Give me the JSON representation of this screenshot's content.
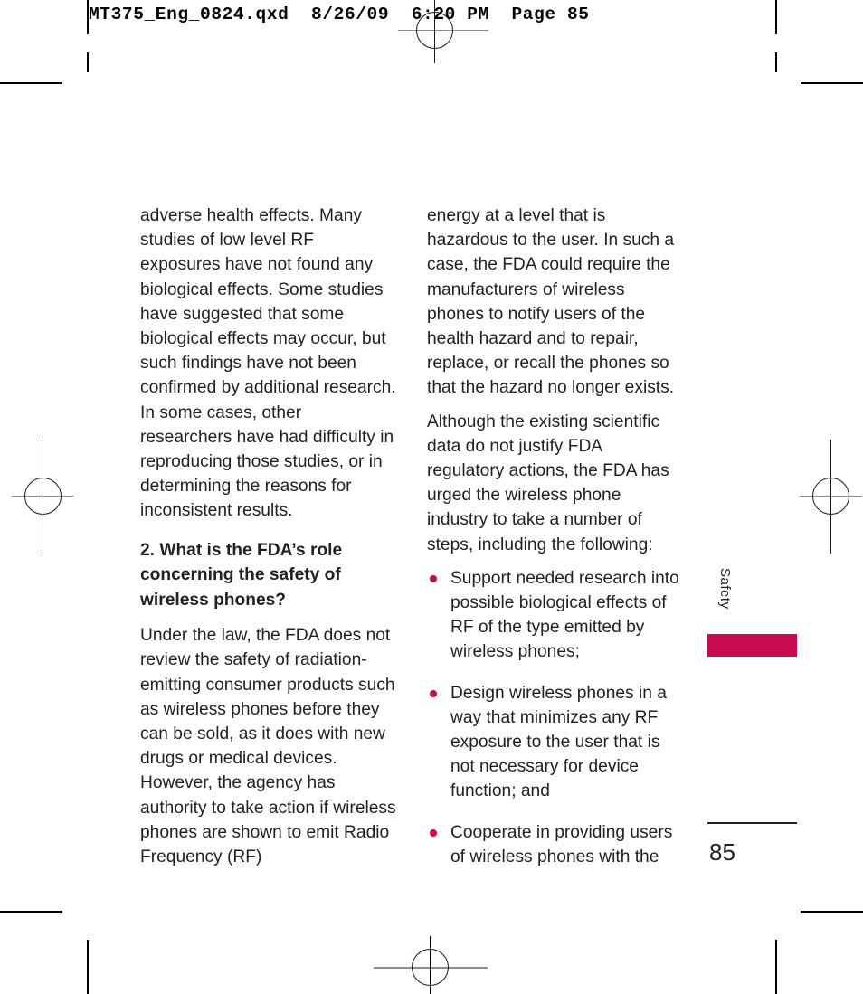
{
  "print_header": {
    "text": "MT375_Eng_0824.qxd  8/26/09  6:20 PM  Page 85"
  },
  "colors": {
    "accent": "#c80a50",
    "text": "#231f20",
    "registration_mark": "#1a1a1a"
  },
  "left_column": {
    "paragraph_1": "adverse health effects. Many studies of low level RF exposures have not found any biological effects. Some studies have suggested that some biological effects may occur, but such findings have not been confirmed by additional research. In some cases, other researchers have had difficulty in reproducing those studies, or in determining the reasons for inconsistent results.",
    "question_heading": "2. What is the FDA’s role concerning the safety of wireless phones?",
    "paragraph_2": "Under the law, the FDA does not review the safety of radiation-emitting consumer products such as wireless phones before they can be sold, as it does with new drugs or medical devices. However, the agency has authority to take action if wireless phones are shown to emit Radio Frequency (RF)"
  },
  "right_column": {
    "paragraph_1": "energy at a level that is hazardous to the user. In such a case, the FDA could require the manufacturers of wireless phones to notify users of the health hazard and to repair, replace, or recall the phones so that the hazard no longer exists.",
    "paragraph_2": "Although the existing scientific data do not justify FDA regulatory actions, the FDA has urged the wireless phone industry to take a number of steps, including the following:",
    "bullets": [
      "Support needed research into possible biological effects of RF of the type emitted by wireless phones;",
      "Design wireless phones in a way that minimizes any RF exposure to the user that is not necessary for device function; and",
      "Cooperate in providing users of wireless phones with the"
    ]
  },
  "side_tab": {
    "label": "Safety"
  },
  "folio": {
    "page_number": "85"
  }
}
